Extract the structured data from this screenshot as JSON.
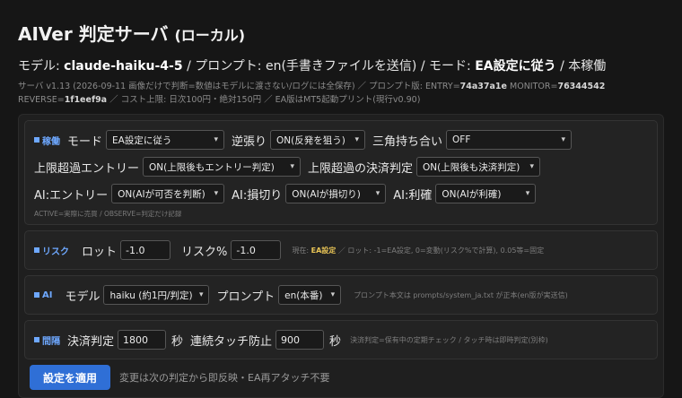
{
  "header": {
    "title": "AIVer 判定サーバ",
    "title_suffix": "(ローカル)",
    "model_label": "モデル:",
    "model_value": "claude-haiku-4-5",
    "prompt_label": "/ プロンプト:",
    "prompt_value": "en(手書きファイルを送信)",
    "mode_label": "/ モード:",
    "mode_value": "EA設定に従う",
    "status_value": "/ 本稼働"
  },
  "meta": {
    "line1_text": "サーバ v1.13 (2026-09-11 画像だけで判断=数値はモデルに渡さない/ログには全保存) ／ プロンプト版: ENTRY=",
    "entry_hash": "74a37a1e",
    "monitor_label": " MONITOR=",
    "monitor_hash": "76344542",
    "reverse_label": "REVERSE=",
    "reverse_hash": "1f1eef9a",
    "line2_rest": " ／ コスト上限: 日次100円・絶対150円 ／ EA版はMT5起動プリント(現行v0.90)"
  },
  "sections": {
    "operation": {
      "tag": "稼働",
      "mode_label": "モード",
      "mode_value": "EA設定に従う",
      "contrarian_label": "逆張り",
      "contrarian_value": "ON(反発を狙う)",
      "triangle_label": "三角持ち合い",
      "triangle_value": "OFF",
      "over_entry_label": "上限超過エントリー",
      "over_entry_value": "ON(上限後もエントリー判定)",
      "over_settle_label": "上限超過の決済判定",
      "over_settle_value": "ON(上限後も決済判定)",
      "ai_entry_label": "AI:エントリー",
      "ai_entry_value": "ON(AIが可否を判断)",
      "ai_stop_label": "AI:損切り",
      "ai_stop_value": "ON(AIが損切り)",
      "ai_take_label": "AI:利確",
      "ai_take_value": "ON(AIが利確)",
      "note": "ACTIVE=実際に売買 / OBSERVE=判定だけ記録"
    },
    "risk": {
      "tag": "リスク",
      "lot_label": "ロット",
      "lot_value": "-1.0",
      "risk_label": "リスク%",
      "risk_value": "-1.0",
      "note_prefix": "現在:",
      "note_highlight": "EA設定",
      "note_rest": "／ ロット: -1=EA設定, 0=変動(リスク%で計算), 0.05等=固定"
    },
    "ai": {
      "tag": "AI",
      "model_label": "モデル",
      "model_value": "haiku (約1円/判定)",
      "prompt_label": "プロンプト",
      "prompt_value": "en(本番)",
      "note": "プロンプト本文は prompts/system_ja.txt が正本(en版が実送信)"
    },
    "interval": {
      "tag": "間隔",
      "settle_label": "決済判定",
      "settle_value": "1800",
      "settle_unit": "秒",
      "touch_label": "連続タッチ防止",
      "touch_value": "900",
      "touch_unit": "秒",
      "note": "決済判定=保有中の定期チェック / タッチ時は即時判定(別枠)"
    }
  },
  "apply": {
    "button_label": "設定を適用",
    "note": "変更は次の判定から即反映・EA再アタッチ不要"
  },
  "icons": {
    "dropdown": "chevron-down-icon",
    "section_marker": "square-icon"
  },
  "colors": {
    "accent": "#2f6fd6",
    "tag": "#6ea8ff",
    "highlight": "#e8c456",
    "background": "#161616"
  }
}
